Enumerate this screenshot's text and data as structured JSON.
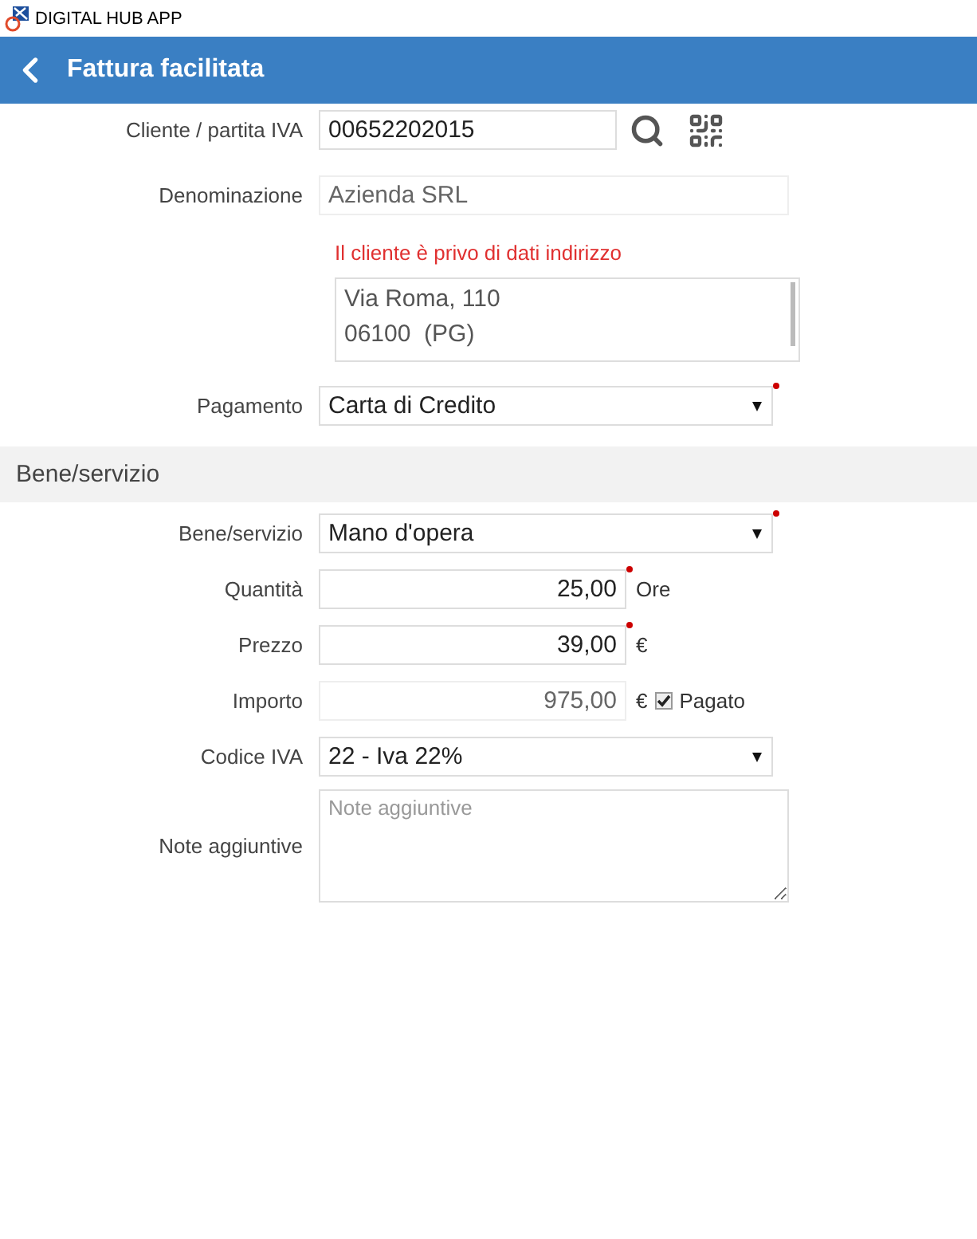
{
  "app_title": "DIGITAL HUB APP",
  "header": {
    "title": "Fattura facilitata"
  },
  "rows": [
    {
      "kind": "lookup",
      "label": "Cliente / partita IVA",
      "value": "00652202015"
    },
    {
      "kind": "readonly",
      "label": "Denominazione",
      "value": "Azienda SRL"
    },
    {
      "kind": "notice",
      "text": "Il cliente è privo di dati indirizzo"
    },
    {
      "kind": "address",
      "lines": [
        "Via Roma, 110",
        "06100  (PG)"
      ]
    },
    {
      "kind": "select",
      "label": "Pagamento",
      "value": "Carta di Credito",
      "required": true
    },
    {
      "kind": "section",
      "title": "Bene/servizio"
    },
    {
      "kind": "select",
      "label": "Bene/servizio",
      "value": "Mano d'opera",
      "required": true
    },
    {
      "kind": "number",
      "label": "Quantità",
      "value": "25,00",
      "required": true,
      "readonly": false,
      "unit": "Ore"
    },
    {
      "kind": "number",
      "label": "Prezzo",
      "value": "39,00",
      "required": true,
      "readonly": false,
      "unit": "€"
    },
    {
      "kind": "number",
      "label": "Importo",
      "value": "975,00",
      "required": false,
      "readonly": true,
      "unit": "€",
      "checkbox": {
        "label": "Pagato",
        "checked": true
      }
    },
    {
      "kind": "select",
      "label": "Codice IVA",
      "value": "22 - Iva 22%",
      "required": false
    },
    {
      "kind": "notes",
      "label": "Note aggiuntive",
      "placeholder": "Note aggiuntive"
    }
  ]
}
